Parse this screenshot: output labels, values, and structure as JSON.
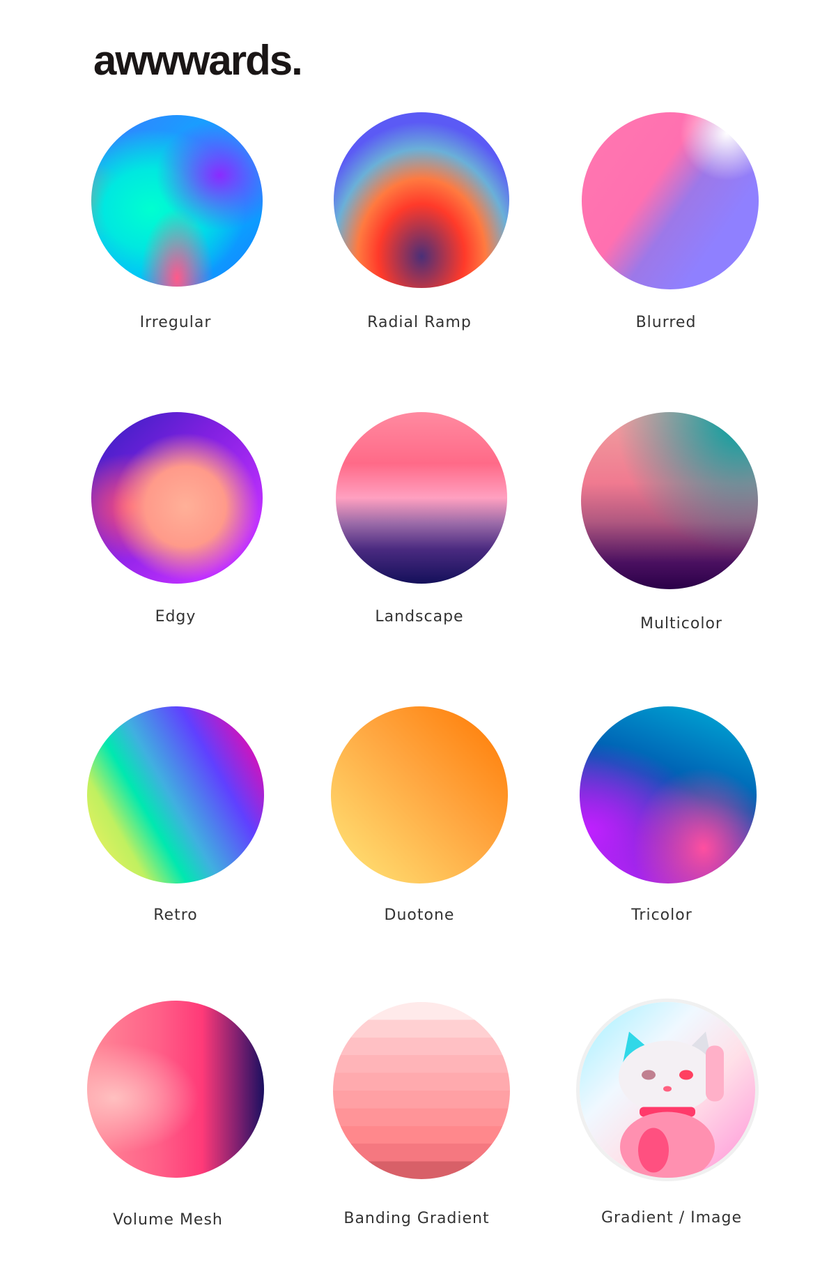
{
  "brand": {
    "logo": "awwwards."
  },
  "gradients": [
    {
      "label": "Irregular",
      "style": "irregular"
    },
    {
      "label": "Radial Ramp",
      "style": "radial"
    },
    {
      "label": "Blurred",
      "style": "blurred"
    },
    {
      "label": "Edgy",
      "style": "edgy"
    },
    {
      "label": "Landscape",
      "style": "landscape"
    },
    {
      "label": "Multicolor",
      "style": "multi"
    },
    {
      "label": "Retro",
      "style": "retro"
    },
    {
      "label": "Duotone",
      "style": "duotone"
    },
    {
      "label": "Tricolor",
      "style": "tricolor"
    },
    {
      "label": "Volume Mesh",
      "style": "volume"
    },
    {
      "label": "Banding Gradient",
      "style": "banding"
    },
    {
      "label": "Gradient / Image",
      "style": "image"
    }
  ]
}
